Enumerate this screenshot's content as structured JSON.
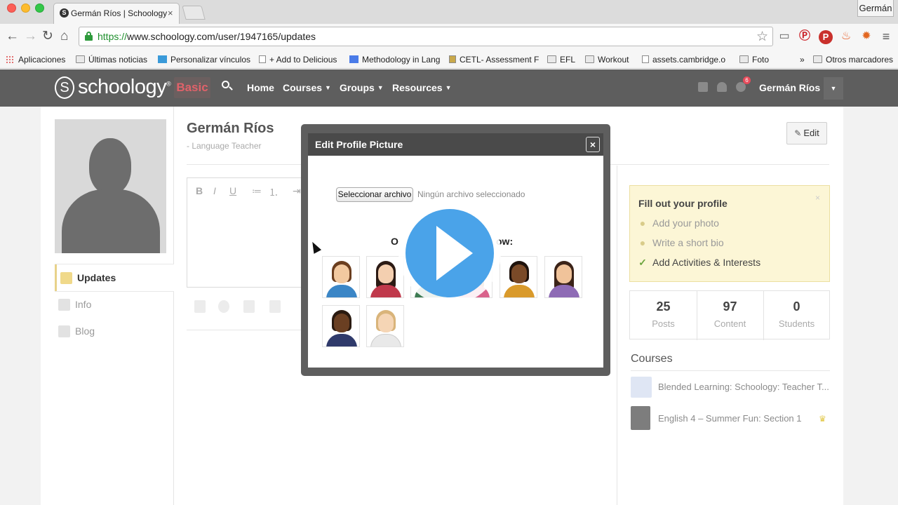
{
  "browser": {
    "tab_title": "Germán Ríos | Schoology",
    "tab_favicon": "S",
    "tab_close": "×",
    "profile_name": "Germán",
    "url_scheme": "https://",
    "url_rest": "www.schoology.com/user/1947165/updates",
    "nav_icons": [
      "back-arrow-icon",
      "forward-arrow-icon",
      "reload-icon",
      "home-icon"
    ],
    "bookmarks": [
      {
        "label": "Aplicaciones",
        "icon": "apps-icon"
      },
      {
        "label": "Últimas noticias",
        "icon": "folder-icon"
      },
      {
        "label": "Personalizar vínculos",
        "icon": "windows-icon"
      },
      {
        "label": "+ Add to Delicious",
        "icon": "page-icon"
      },
      {
        "label": "Methodology in Lang",
        "icon": "google-icon"
      },
      {
        "label": "CETL- Assessment F",
        "icon": "page-icon"
      },
      {
        "label": "EFL",
        "icon": "folder-icon"
      },
      {
        "label": "Workout",
        "icon": "folder-icon"
      },
      {
        "label": "assets.cambridge.o",
        "icon": "page-icon"
      },
      {
        "label": "Foto",
        "icon": "folder-icon"
      },
      {
        "label": "»",
        "icon": "overflow-icon"
      },
      {
        "label": "Otros marcadores",
        "icon": "folder-icon"
      }
    ]
  },
  "header": {
    "logo_mark": "S",
    "logo_text": "schoology",
    "logo_tm": "®",
    "basic_label": "Basic",
    "nav": [
      {
        "label": "Home",
        "has_caret": false
      },
      {
        "label": "Courses",
        "has_caret": true
      },
      {
        "label": "Groups",
        "has_caret": true
      },
      {
        "label": "Resources",
        "has_caret": true
      }
    ],
    "caret": "▼",
    "notification_count": "6",
    "user_name": "Germán Ríos"
  },
  "sidebar": {
    "items": [
      {
        "label": "Updates",
        "active": true
      },
      {
        "label": "Info",
        "active": false
      },
      {
        "label": "Blog",
        "active": false
      }
    ]
  },
  "profile": {
    "name": "Germán Ríos",
    "role": "- Language Teacher",
    "edit_label": "Edit"
  },
  "editor": {
    "buttons": [
      "B",
      "I",
      "U",
      "≔",
      "⒈",
      "⇥"
    ]
  },
  "modal": {
    "title": "Edit Profile Picture",
    "close": "×",
    "file_button": "Seleccionar archivo",
    "file_status": "Ningún archivo seleccionado",
    "choose_before": "O",
    "choose_after": "ow:"
  },
  "fill_profile": {
    "title": "Fill out your profile",
    "close": "×",
    "items": [
      {
        "label": "Add your photo",
        "done": false
      },
      {
        "label": "Write a short bio",
        "done": false
      },
      {
        "label": "Add Activities & Interests",
        "done": true
      }
    ]
  },
  "stats": [
    {
      "value": "25",
      "label": "Posts"
    },
    {
      "value": "97",
      "label": "Content"
    },
    {
      "value": "0",
      "label": "Students"
    }
  ],
  "courses": {
    "title": "Courses",
    "items": [
      {
        "name": "Blended Learning: Schoology: Teacher T..."
      },
      {
        "name": "English 4 – Summer Fun: Section 1",
        "admin": true
      }
    ]
  },
  "video": {
    "state": "paused"
  }
}
